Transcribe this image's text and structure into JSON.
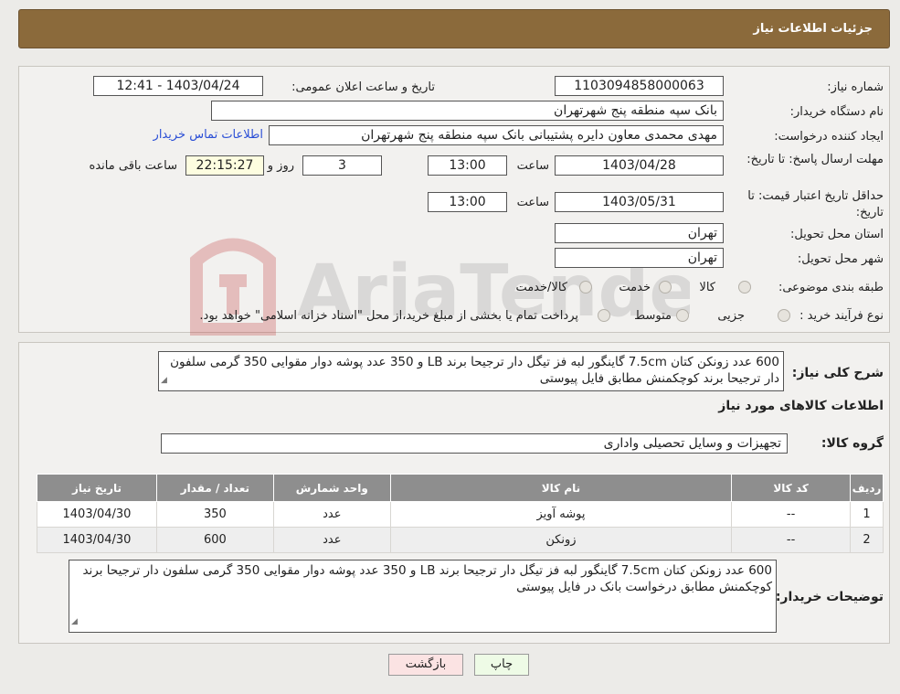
{
  "header": {
    "title": "جزئیات اطلاعات نیاز"
  },
  "info": {
    "need_number_label": "شماره نیاز:",
    "need_number": "1103094858000063",
    "announce_label": "تاریخ و ساعت اعلان عمومی:",
    "announce_value": "1403/04/24 - 12:41",
    "buyer_org_label": "نام دستگاه خریدار:",
    "buyer_org": "بانک سپه منطقه پنج شهرتهران",
    "requester_label": "ایجاد کننده درخواست:",
    "requester": "مهدی محمدی معاون دایره پشتیبانی بانک سپه منطقه پنج شهرتهران",
    "contact_link": "اطلاعات تماس خریدار",
    "deadline_label": "مهلت ارسال پاسخ: تا تاریخ:",
    "deadline_date": "1403/04/28",
    "time_label": "ساعت",
    "deadline_time": "13:00",
    "days_value": "3",
    "days_label": "روز و",
    "remaining_time": "22:15:27",
    "remaining_label": "ساعت باقی مانده",
    "validity_label": "حداقل تاریخ اعتبار قیمت: تا تاریخ:",
    "validity_date": "1403/05/31",
    "validity_time": "13:00",
    "province_label": "استان محل تحویل:",
    "province": "تهران",
    "city_label": "شهر محل تحویل:",
    "city": "تهران",
    "category_label": "طبقه بندی موضوعی:",
    "category_options": [
      "کالا",
      "خدمت",
      "کالا/خدمت"
    ],
    "process_label": "نوع فرآیند خرید :",
    "process_options": [
      "جزیی",
      "متوسط"
    ],
    "process_note": "پرداخت تمام یا بخشی از مبلغ خرید،از محل \"اسناد خزانه اسلامی\" خواهد بود."
  },
  "summary": {
    "description_label": "شرح کلی نیاز:",
    "description": "600 عدد زونکن کتان 7.5cm گاینگور لبه فز تیگل دار  ترجیحا برند LB و 350 عدد پوشه دوار مقوایی 350 گرمی سلفون دار  ترجیحا برند کوچکمنش مطابق فایل پیوستی",
    "goods_info_title": "اطلاعات کالاهای مورد نیاز",
    "goods_group_label": "گروه کالا:",
    "goods_group": "تجهیزات و وسایل تحصیلی واداری"
  },
  "table": {
    "headers": [
      "ردیف",
      "کد کالا",
      "نام کالا",
      "واحد شمارش",
      "تعداد / مقدار",
      "تاریخ نیاز"
    ],
    "rows": [
      [
        "1",
        "--",
        "پوشه آویز",
        "عدد",
        "350",
        "1403/04/30"
      ],
      [
        "2",
        "--",
        "زونکن",
        "عدد",
        "600",
        "1403/04/30"
      ]
    ]
  },
  "buyer_notes": {
    "label": "توضیحات خریدار:",
    "text": "600 عدد زونکن کتان 7.5cm گاینگور لبه فز تیگل دار  ترجیحا برند LB و 350 عدد پوشه دوار مقوایی 350 گرمی سلفون دار ترجیحا برند کوچکمنش مطابق درخواست بانک در فایل پیوستی"
  },
  "buttons": {
    "print": "چاپ",
    "back": "بازگشت"
  },
  "watermark": {
    "text": "AriaTender.neT"
  },
  "colors": {
    "header_bg": "#8b6a3b",
    "table_header_bg": "#8e8e8e",
    "link": "#2b4fd6",
    "back_button_bg": "#fbe3e3",
    "print_button_bg": "#eefbe6"
  }
}
